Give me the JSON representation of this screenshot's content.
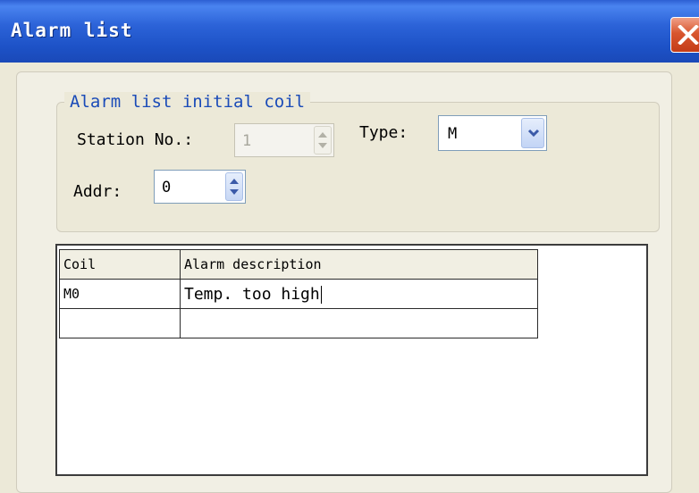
{
  "window": {
    "title": "Alarm list"
  },
  "group": {
    "legend": "Alarm list initial coil",
    "station_label": "Station No.:",
    "station_value": "1",
    "type_label": "Type:",
    "type_value": "M",
    "addr_label": "Addr:",
    "addr_value": "0"
  },
  "table": {
    "headers": [
      "Coil",
      "Alarm description"
    ],
    "rows": [
      [
        "M0",
        "Temp. too high"
      ],
      [
        "",
        ""
      ]
    ]
  },
  "icons": {
    "close": "close-icon",
    "spin": "spinner-arrows-icon",
    "dropdown": "chevron-down-icon"
  },
  "colors": {
    "titlebar": "#2c63d8",
    "close_button": "#d8562f",
    "legend_text": "#1a4bb8",
    "dialog_bg": "#ece9d8"
  }
}
